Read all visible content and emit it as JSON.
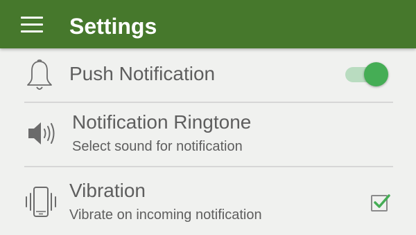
{
  "toolbar": {
    "title": "Settings",
    "menu_icon": "hamburger-menu-icon",
    "background_color": "#46782c"
  },
  "settings": {
    "push_notification": {
      "title": "Push Notification",
      "icon": "bell-icon",
      "enabled": true,
      "switch_color": "#45ad55"
    },
    "ringtone": {
      "title": "Notification Ringtone",
      "subtitle": "Select sound for notification",
      "icon": "speaker-icon"
    },
    "vibration": {
      "title": "Vibration",
      "subtitle": "Vibrate on incoming notification",
      "icon": "vibrating-phone-icon",
      "checked": true,
      "check_color": "#45ad55"
    }
  }
}
